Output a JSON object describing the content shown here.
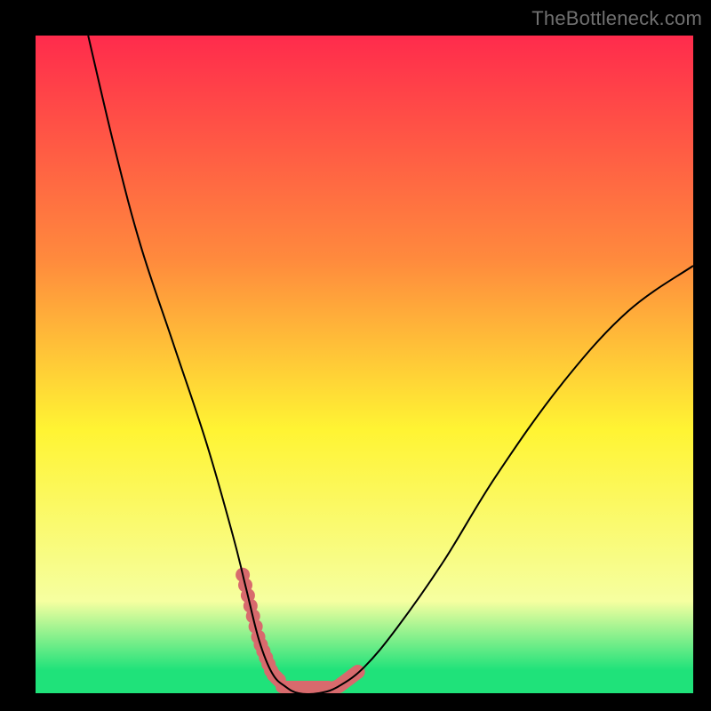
{
  "attribution": "TheBottleneck.com",
  "colors": {
    "bg_black": "#000000",
    "curve": "#000000",
    "highlight": "#d86a6d",
    "grad_top": "#ff2b4c",
    "grad_mid_upper": "#ff8a3d",
    "grad_mid": "#fff433",
    "grad_lower": "#f6ffa0",
    "grad_bottom": "#1fe27a"
  },
  "chart_data": {
    "type": "line",
    "title": "",
    "xlabel": "",
    "ylabel": "",
    "xlim": [
      0,
      100
    ],
    "ylim": [
      0,
      100
    ],
    "series": [
      {
        "name": "bottleneck-curve",
        "x": [
          8,
          12,
          16,
          21,
          26,
          30,
          32,
          34,
          36,
          38,
          40,
          43,
          46,
          50,
          55,
          62,
          70,
          80,
          90,
          100
        ],
        "y": [
          100,
          83,
          68,
          53,
          38,
          24,
          16,
          8,
          3,
          1,
          0,
          0,
          1,
          4,
          10,
          20,
          33,
          47,
          58,
          65
        ]
      }
    ],
    "highlight_segments": [
      {
        "name": "left-knee",
        "x_range": [
          31.5,
          37
        ],
        "y_range": [
          0.5,
          18
        ]
      },
      {
        "name": "right-knee",
        "x_range": [
          44.5,
          49
        ],
        "y_range": [
          0.5,
          9
        ]
      }
    ],
    "gradient_stops": [
      {
        "offset": 0.0,
        "color_key": "grad_top"
      },
      {
        "offset": 0.34,
        "color_key": "grad_mid_upper"
      },
      {
        "offset": 0.6,
        "color_key": "grad_mid"
      },
      {
        "offset": 0.86,
        "color_key": "grad_lower"
      },
      {
        "offset": 0.965,
        "color_key": "grad_bottom"
      },
      {
        "offset": 1.0,
        "color_key": "grad_bottom"
      }
    ]
  }
}
